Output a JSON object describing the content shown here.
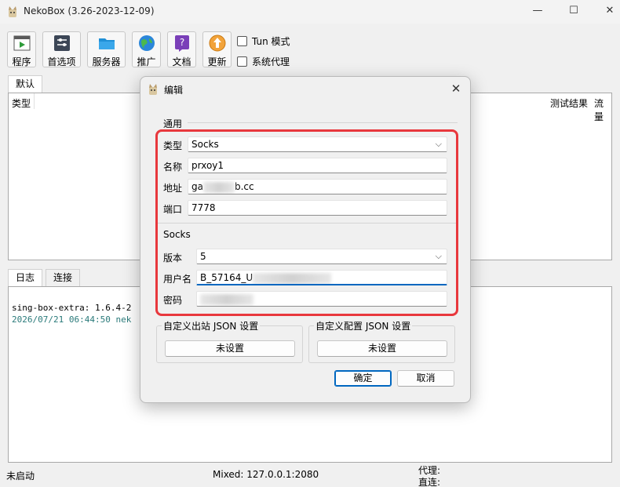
{
  "window": {
    "title": "NekoBox (3.26-2023-12-09)",
    "minimize": "—",
    "maximize": "☐",
    "close": "✕"
  },
  "toolbar": {
    "program": "程序",
    "preferences": "首选项",
    "servers": "服务器",
    "promote": "推广",
    "docs": "文档",
    "update": "更新",
    "tun_mode": "Tun 模式",
    "system_proxy": "系统代理"
  },
  "group_tab": "默认",
  "server_table": {
    "col_type": "类型",
    "col_test": "测试结果",
    "col_traffic": "流量"
  },
  "bottom_tabs": {
    "log": "日志",
    "connections": "连接"
  },
  "log_lines": [
    "sing-box-extra: 1.6.4-2",
    "2026/07/21 06:44:50 nek"
  ],
  "statusbar": {
    "state": "未启动",
    "mixed": "Mixed: 127.0.0.1:2080",
    "proxy": "代理:",
    "direct": "直连:"
  },
  "dialog": {
    "title": "编辑",
    "close": "✕",
    "general_section": "通用",
    "type_label": "类型",
    "type_value": "Socks",
    "name_label": "名称",
    "name_value": "prxoy1",
    "address_label": "地址",
    "address_prefix": "ga",
    "address_suffix": "b.cc",
    "port_label": "端口",
    "port_value": "7778",
    "socks_section": "Socks",
    "version_label": "版本",
    "version_value": "5",
    "username_label": "用户名",
    "username_value": "B_57164_U",
    "password_label": "密码",
    "outbound_title": "自定义出站 JSON 设置",
    "outbound_button": "未设置",
    "config_title": "自定义配置 JSON 设置",
    "config_button": "未设置",
    "ok": "确定",
    "cancel": "取消"
  },
  "colors": {
    "highlight_border": "#e8383d",
    "focus_accent": "#0067c0",
    "log_timestamp": "#2a7a7a"
  },
  "icons": {
    "app": "neko-cat-icon",
    "program": "play-window-icon",
    "preferences": "sliders-icon",
    "servers": "folder-icon",
    "promote": "globe-icon",
    "docs": "help-doc-icon",
    "update": "upgrade-arrow-icon"
  }
}
